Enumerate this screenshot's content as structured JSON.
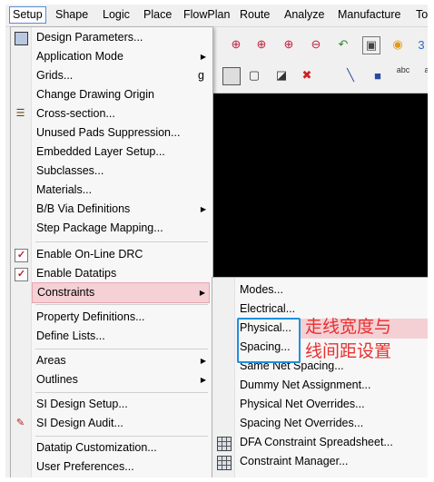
{
  "menubar": {
    "items": [
      "Setup",
      "Shape",
      "Logic",
      "Place",
      "FlowPlan",
      "Route",
      "Analyze",
      "Manufacture",
      "To"
    ]
  },
  "setup_menu": {
    "items": [
      {
        "label": "Design Parameters..."
      },
      {
        "label": "Application Mode",
        "submenu": true
      },
      {
        "label": "Grids...",
        "shortcut": "g"
      },
      {
        "label": "Change Drawing Origin"
      },
      {
        "label": "Cross-section..."
      },
      {
        "label": "Unused Pads Suppression..."
      },
      {
        "label": "Embedded Layer Setup..."
      },
      {
        "label": "Subclasses..."
      },
      {
        "label": "Materials..."
      },
      {
        "label": "B/B Via Definitions",
        "submenu": true
      },
      {
        "label": "Step Package Mapping..."
      },
      {
        "label": "Enable On-Line DRC",
        "checked": true
      },
      {
        "label": "Enable Datatips",
        "checked": true
      },
      {
        "label": "Constraints",
        "submenu": true,
        "highlighted": true
      },
      {
        "label": "Property Definitions..."
      },
      {
        "label": "Define Lists..."
      },
      {
        "label": "Areas",
        "submenu": true
      },
      {
        "label": "Outlines",
        "submenu": true
      },
      {
        "label": "SI Design Setup..."
      },
      {
        "label": "SI Design Audit..."
      },
      {
        "label": "Datatip Customization..."
      },
      {
        "label": "User Preferences..."
      }
    ]
  },
  "constraints_submenu": {
    "items": [
      {
        "label": "Modes..."
      },
      {
        "label": "Electrical..."
      },
      {
        "label": "Physical..."
      },
      {
        "label": "Spacing..."
      },
      {
        "label": "Same Net Spacing..."
      },
      {
        "label": "Dummy Net Assignment..."
      },
      {
        "label": "Physical Net Overrides..."
      },
      {
        "label": "Spacing Net Overrides..."
      },
      {
        "label": "DFA Constraint Spreadsheet..."
      },
      {
        "label": "Constraint Manager..."
      }
    ]
  },
  "annotation": {
    "line1": "走线宽度与",
    "line2": "线间距设置",
    "color": "#e8302e"
  },
  "colors": {
    "highlight": "#f5d0d5",
    "callout_border": "#1f8fe0",
    "canvas": "#000000"
  }
}
